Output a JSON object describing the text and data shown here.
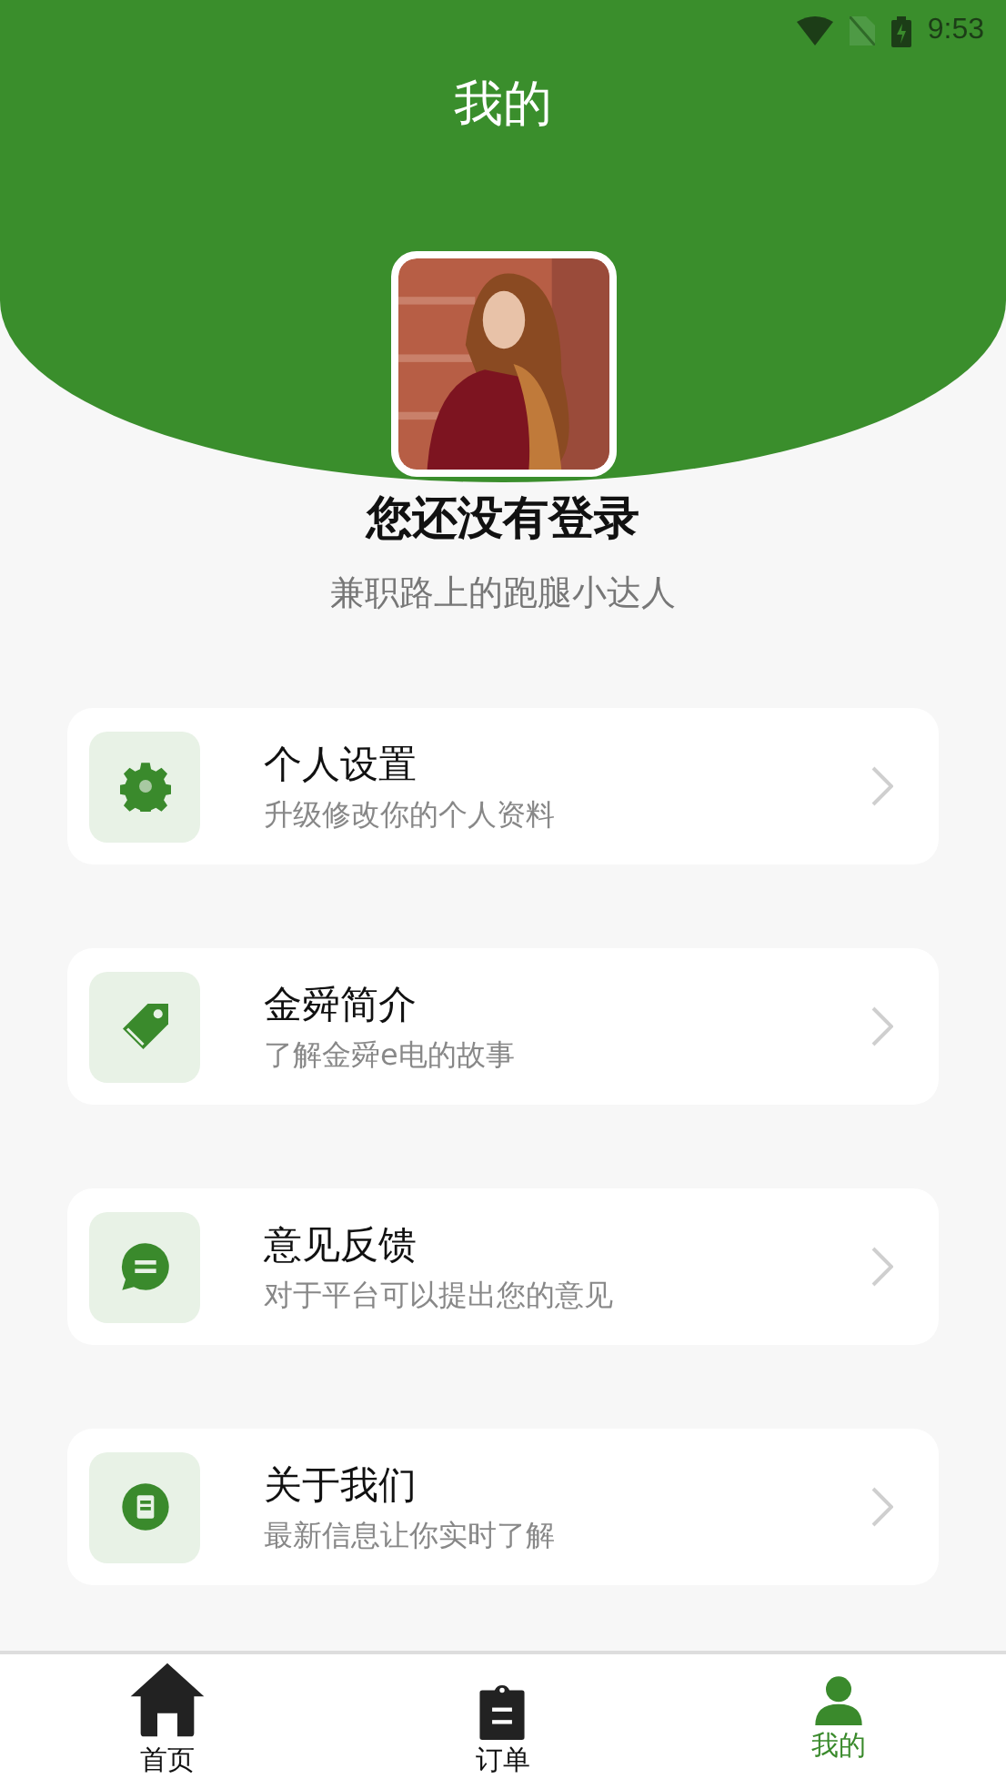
{
  "status_bar": {
    "time": "9:53"
  },
  "header": {
    "title": "我的"
  },
  "profile": {
    "name": "您还没有登录",
    "tagline": "兼职路上的跑腿小达人"
  },
  "menu": [
    {
      "kind": "gear",
      "title": "个人设置",
      "subtitle": "升级修改你的个人资料"
    },
    {
      "kind": "tag",
      "title": "金舜简介",
      "subtitle": "了解金舜e电的故事"
    },
    {
      "kind": "chat",
      "title": "意见反馈",
      "subtitle": "对于平台可以提出您的意见"
    },
    {
      "kind": "info",
      "title": "关于我们",
      "subtitle": "最新信息让你实时了解"
    }
  ],
  "tabs": [
    {
      "kind": "home",
      "label": "首页",
      "selected": false
    },
    {
      "kind": "clipboard",
      "label": "订单",
      "selected": false
    },
    {
      "kind": "person",
      "label": "我的",
      "selected": true
    }
  ]
}
